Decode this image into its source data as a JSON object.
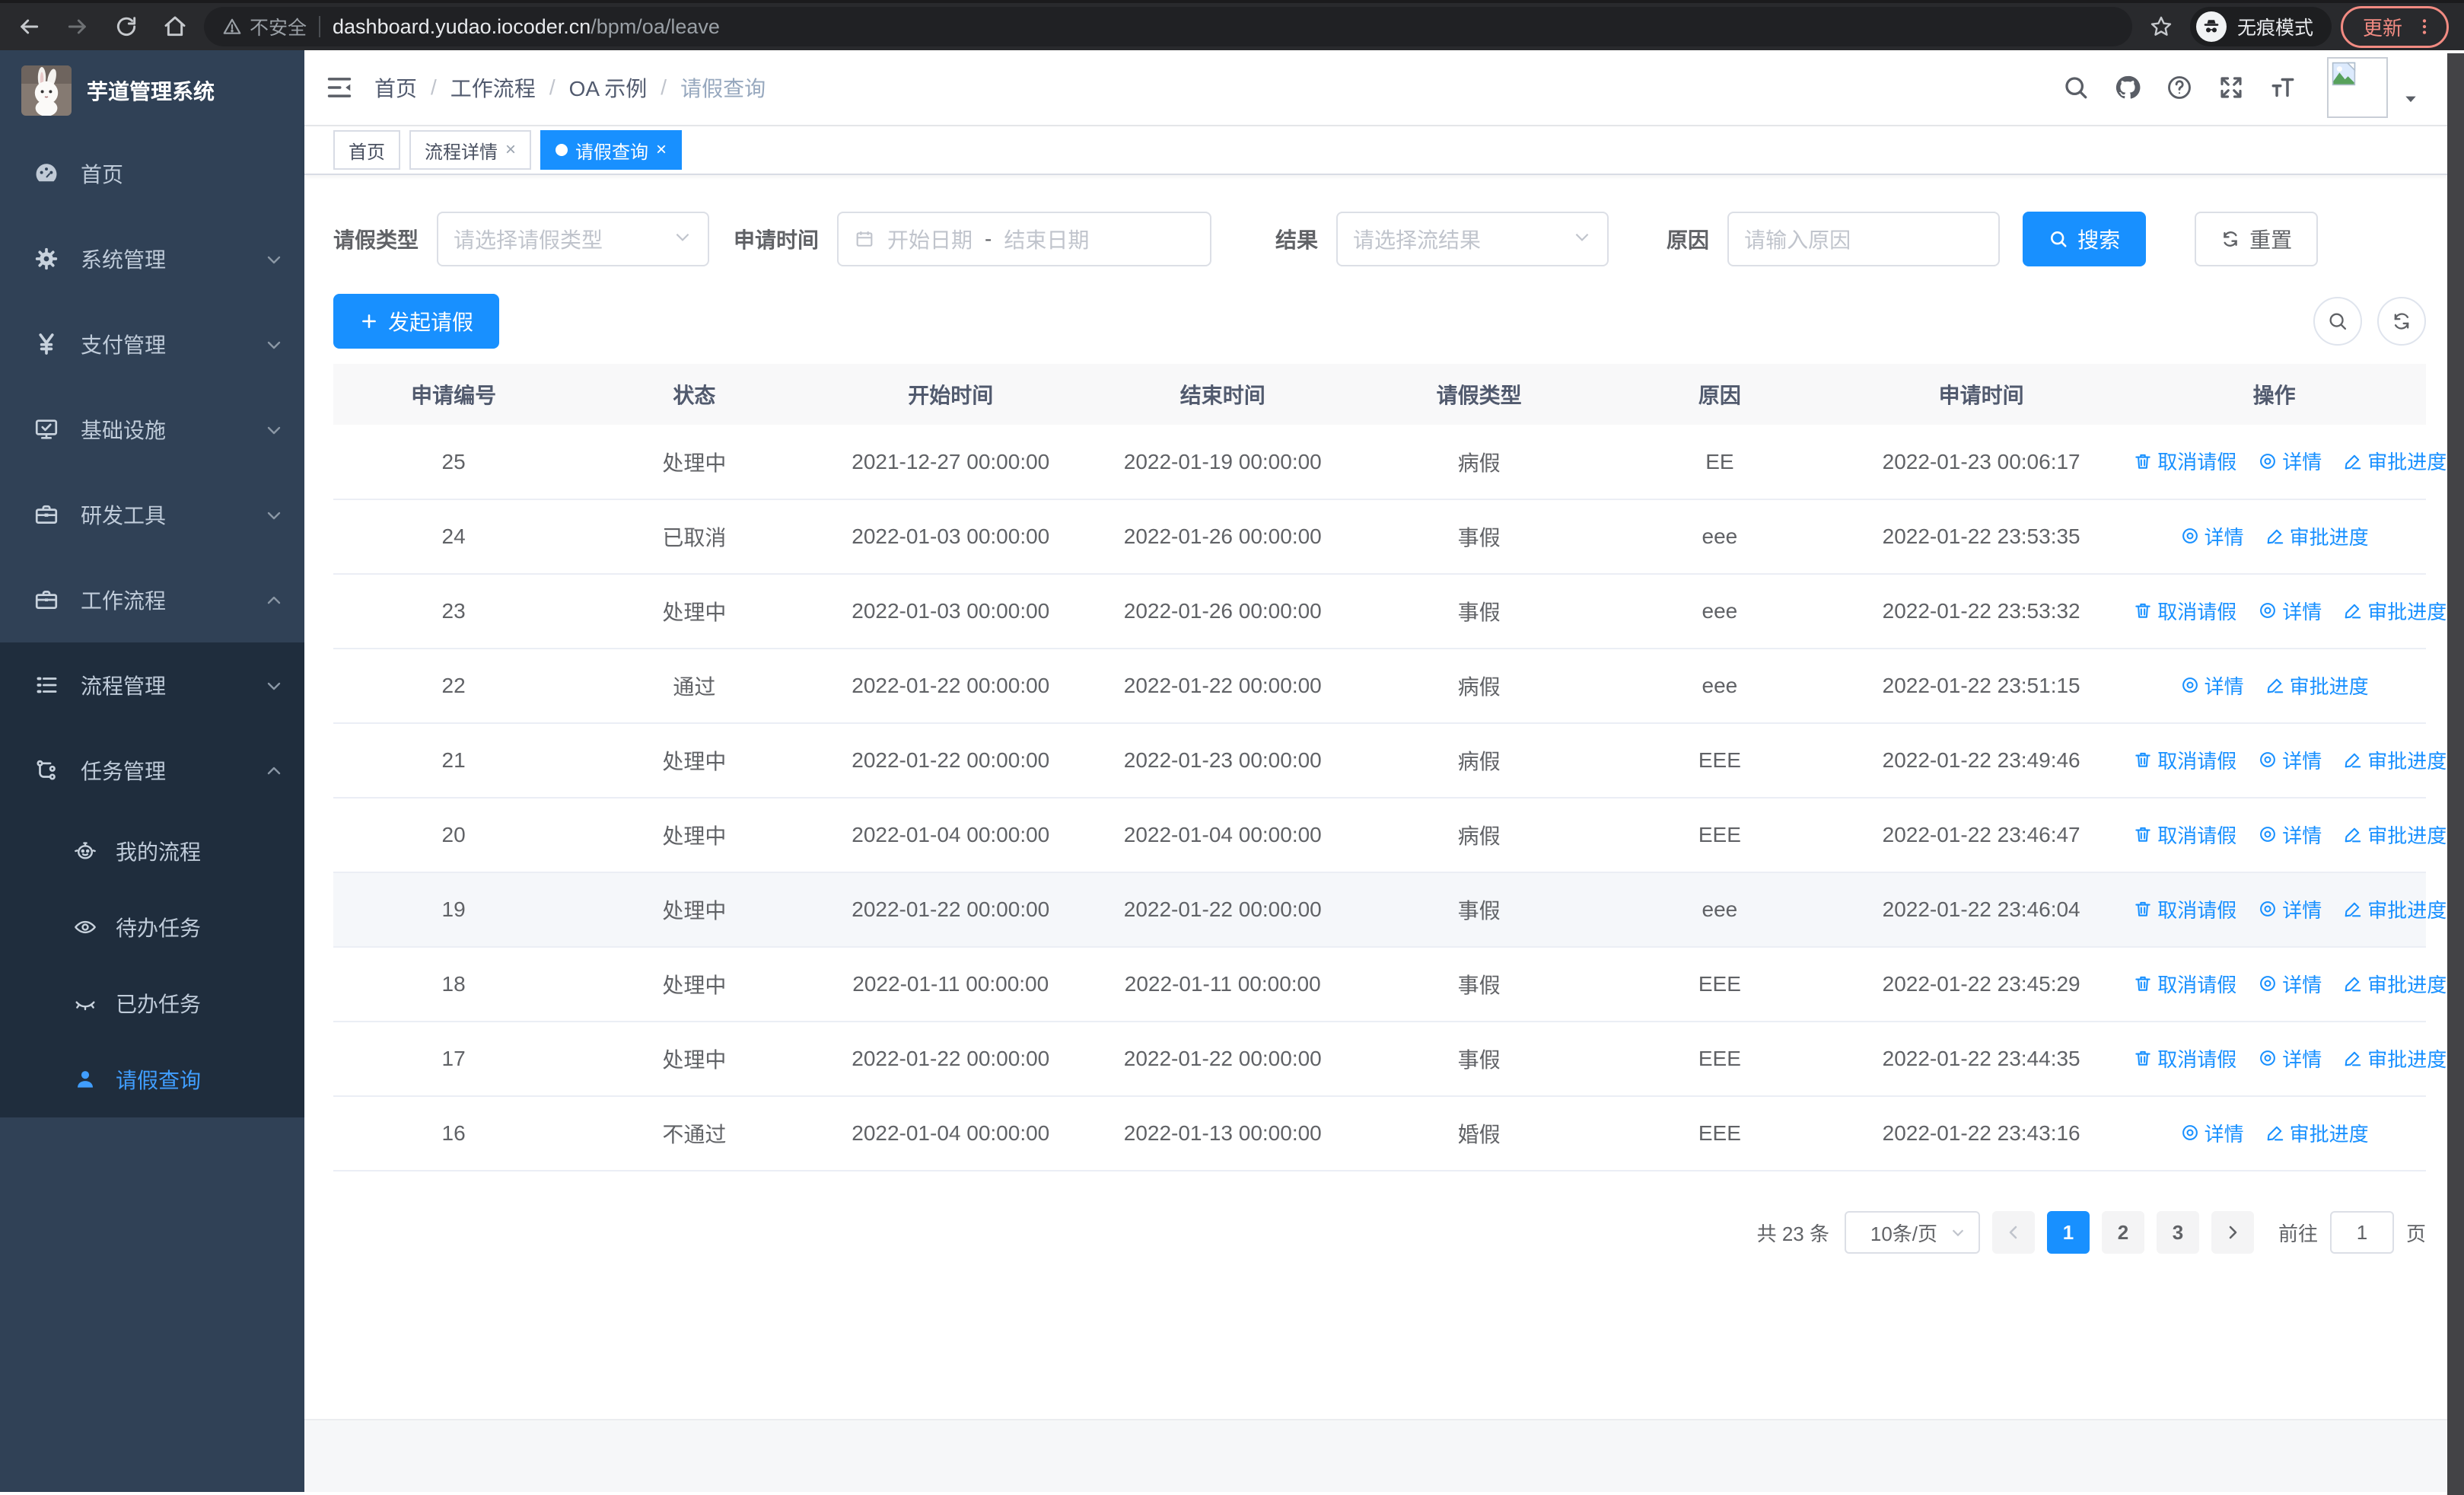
{
  "colors": {
    "primary": "#1890ff",
    "sidebar_active": "#409eff",
    "sidebar_bg": "#304156",
    "submenu_bg": "#1f2d3d",
    "update_accent": "#f28b82"
  },
  "browser": {
    "security_label": "不安全",
    "url_host": "dashboard.yudao.iocoder.cn",
    "url_path": "/bpm/oa/leave",
    "incognito_label": "无痕模式",
    "update_label": "更新"
  },
  "sidebar": {
    "app_title": "芋道管理系统",
    "items": [
      {
        "label": "首页"
      },
      {
        "label": "系统管理"
      },
      {
        "label": "支付管理"
      },
      {
        "label": "基础设施"
      },
      {
        "label": "研发工具"
      },
      {
        "label": "工作流程"
      }
    ],
    "workflow_children": [
      {
        "label": "流程管理"
      },
      {
        "label": "任务管理"
      }
    ],
    "task_children": [
      {
        "label": "我的流程"
      },
      {
        "label": "待办任务"
      },
      {
        "label": "已办任务"
      },
      {
        "label": "请假查询"
      }
    ]
  },
  "header": {
    "breadcrumb": [
      "首页",
      "工作流程",
      "OA 示例",
      "请假查询"
    ]
  },
  "tags": [
    {
      "label": "首页"
    },
    {
      "label": "流程详情"
    },
    {
      "label": "请假查询"
    }
  ],
  "filters": {
    "type_label": "请假类型",
    "type_placeholder": "请选择请假类型",
    "time_label": "申请时间",
    "start_placeholder": "开始日期",
    "range_separator": "-",
    "end_placeholder": "结束日期",
    "result_label": "结果",
    "result_placeholder": "请选择流结果",
    "reason_label": "原因",
    "reason_placeholder": "请输入原因",
    "search_label": "搜索",
    "reset_label": "重置"
  },
  "toolbar": {
    "create_label": "发起请假"
  },
  "table": {
    "columns": [
      "申请编号",
      "状态",
      "开始时间",
      "结束时间",
      "请假类型",
      "原因",
      "申请时间",
      "操作"
    ],
    "action_labels": {
      "cancel": "取消请假",
      "detail": "详情",
      "progress": "审批进度"
    },
    "rows": [
      {
        "id": "25",
        "status": "处理中",
        "start_time": "2021-12-27 00:00:00",
        "end_time": "2022-01-19 00:00:00",
        "leave_type": "病假",
        "reason": "EE",
        "apply_time": "2022-01-23 00:06:17",
        "actions": [
          "cancel",
          "detail",
          "progress"
        ],
        "highlighted": false
      },
      {
        "id": "24",
        "status": "已取消",
        "start_time": "2022-01-03 00:00:00",
        "end_time": "2022-01-26 00:00:00",
        "leave_type": "事假",
        "reason": "eee",
        "apply_time": "2022-01-22 23:53:35",
        "actions": [
          "detail",
          "progress"
        ],
        "highlighted": false
      },
      {
        "id": "23",
        "status": "处理中",
        "start_time": "2022-01-03 00:00:00",
        "end_time": "2022-01-26 00:00:00",
        "leave_type": "事假",
        "reason": "eee",
        "apply_time": "2022-01-22 23:53:32",
        "actions": [
          "cancel",
          "detail",
          "progress"
        ],
        "highlighted": false
      },
      {
        "id": "22",
        "status": "通过",
        "start_time": "2022-01-22 00:00:00",
        "end_time": "2022-01-22 00:00:00",
        "leave_type": "病假",
        "reason": "eee",
        "apply_time": "2022-01-22 23:51:15",
        "actions": [
          "detail",
          "progress"
        ],
        "highlighted": false
      },
      {
        "id": "21",
        "status": "处理中",
        "start_time": "2022-01-22 00:00:00",
        "end_time": "2022-01-23 00:00:00",
        "leave_type": "病假",
        "reason": "EEE",
        "apply_time": "2022-01-22 23:49:46",
        "actions": [
          "cancel",
          "detail",
          "progress"
        ],
        "highlighted": false
      },
      {
        "id": "20",
        "status": "处理中",
        "start_time": "2022-01-04 00:00:00",
        "end_time": "2022-01-04 00:00:00",
        "leave_type": "病假",
        "reason": "EEE",
        "apply_time": "2022-01-22 23:46:47",
        "actions": [
          "cancel",
          "detail",
          "progress"
        ],
        "highlighted": false
      },
      {
        "id": "19",
        "status": "处理中",
        "start_time": "2022-01-22 00:00:00",
        "end_time": "2022-01-22 00:00:00",
        "leave_type": "事假",
        "reason": "eee",
        "apply_time": "2022-01-22 23:46:04",
        "actions": [
          "cancel",
          "detail",
          "progress"
        ],
        "highlighted": true
      },
      {
        "id": "18",
        "status": "处理中",
        "start_time": "2022-01-11 00:00:00",
        "end_time": "2022-01-11 00:00:00",
        "leave_type": "事假",
        "reason": "EEE",
        "apply_time": "2022-01-22 23:45:29",
        "actions": [
          "cancel",
          "detail",
          "progress"
        ],
        "highlighted": false
      },
      {
        "id": "17",
        "status": "处理中",
        "start_time": "2022-01-22 00:00:00",
        "end_time": "2022-01-22 00:00:00",
        "leave_type": "事假",
        "reason": "EEE",
        "apply_time": "2022-01-22 23:44:35",
        "actions": [
          "cancel",
          "detail",
          "progress"
        ],
        "highlighted": false
      },
      {
        "id": "16",
        "status": "不通过",
        "start_time": "2022-01-04 00:00:00",
        "end_time": "2022-01-13 00:00:00",
        "leave_type": "婚假",
        "reason": "EEE",
        "apply_time": "2022-01-22 23:43:16",
        "actions": [
          "detail",
          "progress"
        ],
        "highlighted": false
      }
    ]
  },
  "pagination": {
    "total_label": "共 23 条",
    "page_size_label": "10条/页",
    "pages": [
      "1",
      "2",
      "3"
    ],
    "current_page": "1",
    "goto_label": "前往",
    "goto_value": "1",
    "unit_label": "页"
  }
}
